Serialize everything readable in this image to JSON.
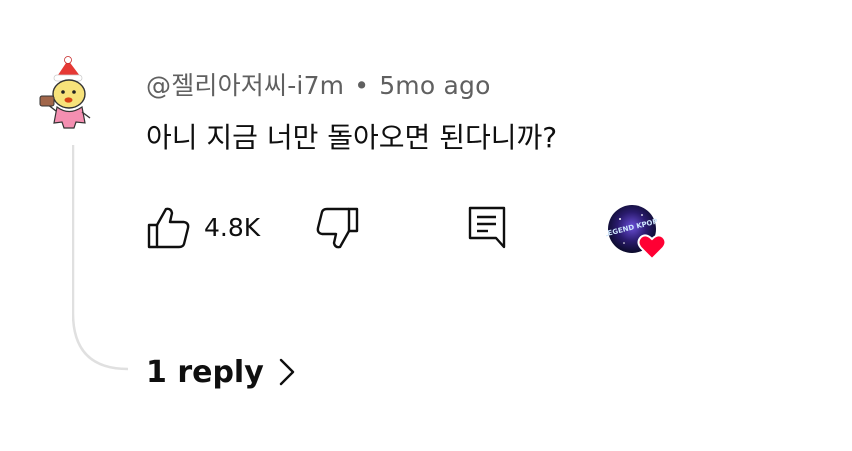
{
  "comment": {
    "author": "@젤리아저씨-i7m",
    "separator": "•",
    "timestamp": "5mo ago",
    "text": "아니 지금 너만 돌아오면 된다니까?",
    "like_count": "4.8K",
    "replies_label": "1 reply",
    "creator_heart_badge_text": "LEGEND KPOP"
  },
  "icons": {
    "like": "thumbs-up-icon",
    "dislike": "thumbs-down-icon",
    "reply": "comment-reply-icon",
    "replies_chevron": "chevron-right-icon",
    "heart": "heart-icon"
  },
  "colors": {
    "heart": "#ff0033",
    "meta_text": "#606060",
    "primary_text": "#0f0f0f",
    "thread_line": "#e0e0e0"
  }
}
